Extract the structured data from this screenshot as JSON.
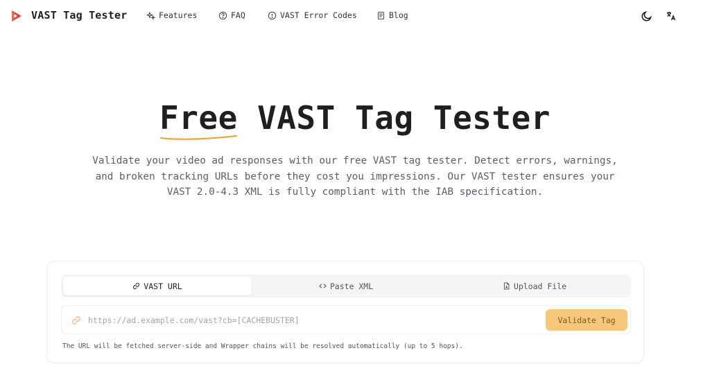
{
  "header": {
    "brand": "VAST Tag Tester",
    "nav": [
      {
        "label": "Features",
        "icon": "sparkles-icon"
      },
      {
        "label": "FAQ",
        "icon": "help-circle-icon"
      },
      {
        "label": "VAST Error Codes",
        "icon": "alert-circle-icon"
      },
      {
        "label": "Blog",
        "icon": "newspaper-icon"
      }
    ],
    "theme_icon": "moon-icon",
    "language_icon": "translate-icon"
  },
  "hero": {
    "title_highlight": "Free",
    "title_rest": " VAST Tag Tester",
    "description": "Validate your video ad responses with our free VAST tag tester. Detect errors, warnings, and broken tracking URLs before they cost you impressions. Our VAST tester ensures your VAST 2.0-4.3 XML is fully compliant with the IAB specification."
  },
  "validator": {
    "tabs": [
      {
        "label": "VAST URL",
        "icon": "link-icon",
        "active": true
      },
      {
        "label": "Paste XML",
        "icon": "code-icon",
        "active": false
      },
      {
        "label": "Upload File",
        "icon": "file-icon",
        "active": false
      }
    ],
    "input": {
      "placeholder": "https://ad.example.com/vast?cb=[CACHEBUSTER]",
      "value": ""
    },
    "submit_label": "Validate Tag",
    "hint": "The URL will be fetched server-side and Wrapper chains will be resolved automatically (up to 5 hops)."
  },
  "colors": {
    "accent": "#f7c77a",
    "brand_red": "#e0452f",
    "underline": "#f0a020"
  }
}
